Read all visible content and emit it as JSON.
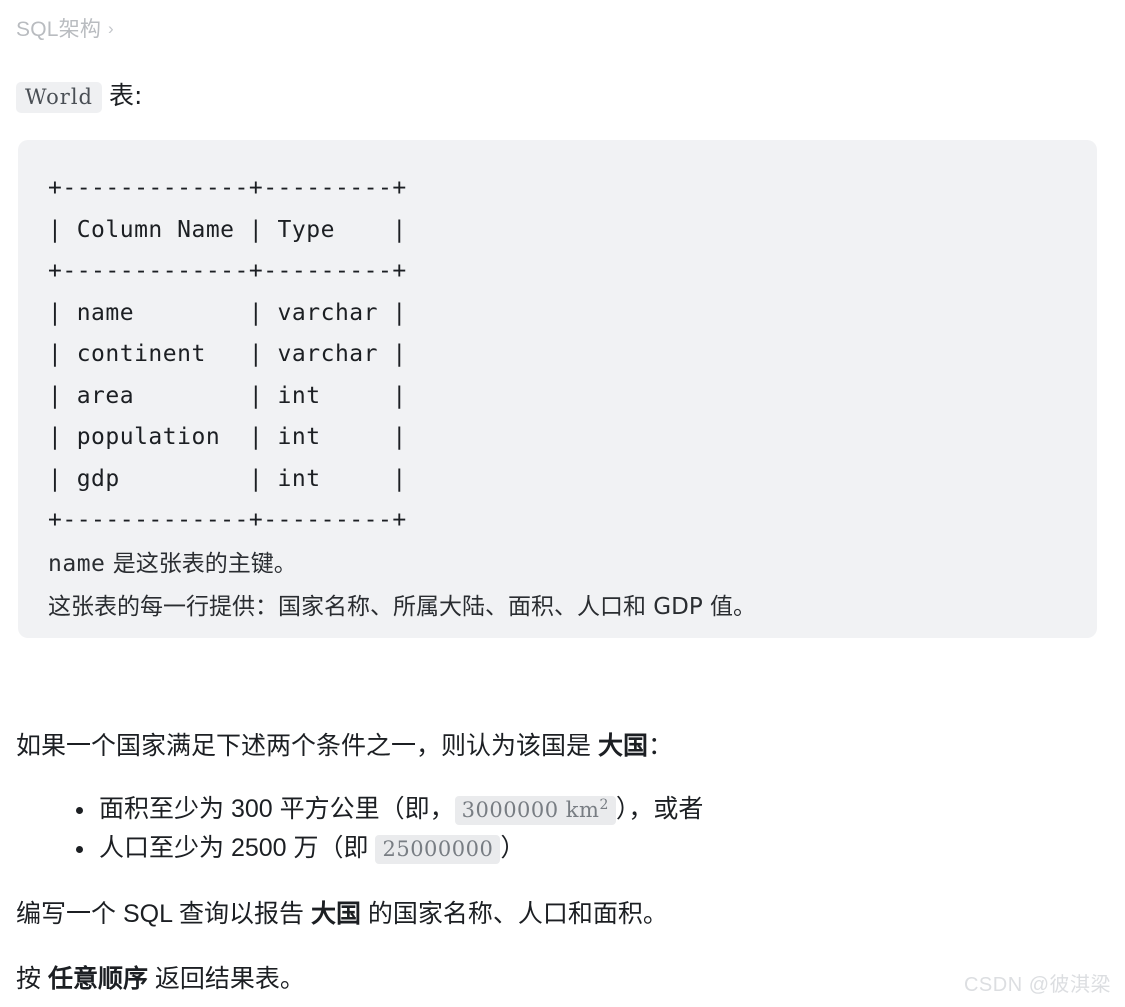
{
  "breadcrumb": {
    "label": "SQL架构",
    "separator": "›"
  },
  "table_title": {
    "code": "World",
    "text": "表:"
  },
  "schema_block": {
    "ascii_table": "+-------------+---------+\n| Column Name | Type    |\n+-------------+---------+\n| name        | varchar |\n| continent   | varchar |\n| area        | int     |\n| population  | int     |\n| gdp         | int     |\n+-------------+---------+",
    "columns": [
      {
        "name": "name",
        "type": "varchar"
      },
      {
        "name": "continent",
        "type": "varchar"
      },
      {
        "name": "area",
        "type": "int"
      },
      {
        "name": "population",
        "type": "int"
      },
      {
        "name": "gdp",
        "type": "int"
      }
    ],
    "note_primary_key_code": "name",
    "note_primary_key_text": "是这张表的主键。",
    "note_description": "这张表的每一行提供：国家名称、所属大陆、面积、人口和 GDP 值。"
  },
  "condition_paragraph": {
    "prefix": "如果一个国家满足下述两个条件之一，则认为该国是 ",
    "strong": "大国",
    "suffix": "："
  },
  "bullets": [
    {
      "prefix": "面积至少为 300 平方公里（即，",
      "code_text": "3000000 km",
      "code_sup": "2",
      "suffix": "），或者"
    },
    {
      "prefix": "人口至少为 2500 万（即 ",
      "code_text": "25000000",
      "code_sup": "",
      "suffix": "）"
    }
  ],
  "write_paragraph": {
    "prefix": "编写一个 SQL 查询以报告 ",
    "strong": "大国",
    "suffix": " 的国家名称、人口和面积。"
  },
  "order_paragraph": {
    "prefix": "按 ",
    "strong": "任意顺序",
    "suffix": " 返回结果表。"
  },
  "watermark": {
    "text": "CSDN @彼淇梁"
  },
  "colors": {
    "page_background": "#ffffff",
    "code_block_background": "#f1f2f4",
    "inline_code_background": "#eff0f2",
    "body_text": "#1c1f23",
    "breadcrumb_text": "#b9bcc0",
    "watermark_text": "#dcdee1"
  }
}
